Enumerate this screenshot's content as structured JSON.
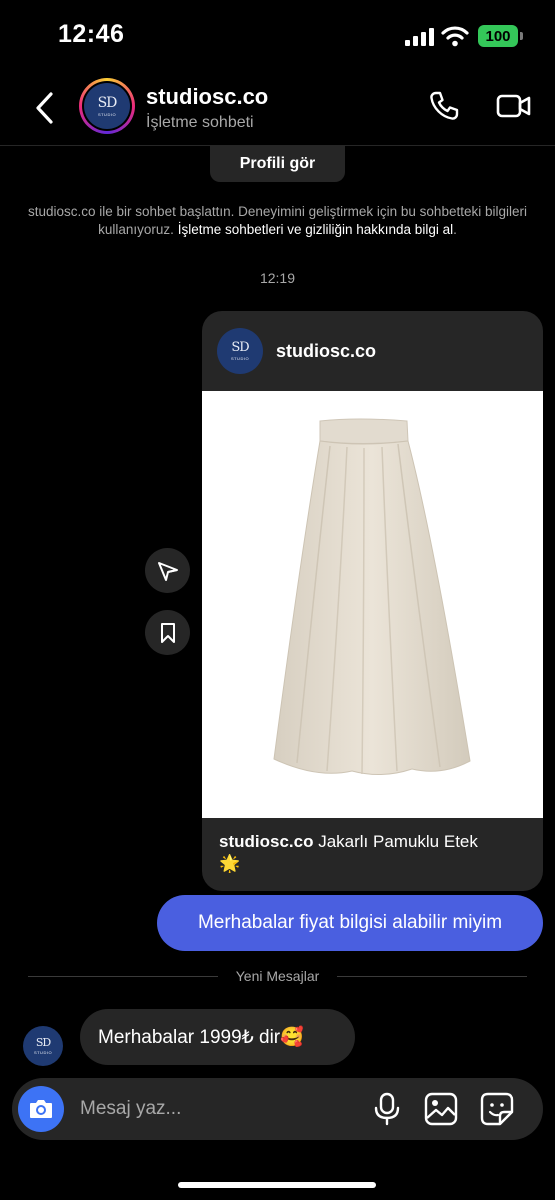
{
  "status_bar": {
    "time": "12:46",
    "battery": "100"
  },
  "header": {
    "title": "studiosc.co",
    "subtitle": "İşletme sohbeti"
  },
  "logo": {
    "monogram": "SD",
    "sub": "STUDIO"
  },
  "profile_button": "Profili gör",
  "info": {
    "text": "studiosc.co ile bir sohbet başlattın. Deneyimini geliştirmek için bu sohbetteki bilgileri kullanıyoruz. ",
    "link": "İşletme sohbetleri ve gizliliğin hakkında bilgi al",
    "end": "."
  },
  "timestamp": "12:19",
  "post": {
    "username": "studiosc.co",
    "caption_user": "studiosc.co",
    "caption_text": " Jakarlı Pamuklu Etek",
    "caption_emoji": "🌟"
  },
  "sent_message": "Merhabalar fiyat bilgisi alabilir miyim",
  "divider_label": "Yeni Mesajlar",
  "received_message": "Merhabalar 1999₺ dir🥰",
  "composer": {
    "placeholder": "Mesaj yaz..."
  },
  "colors": {
    "background": "#000000",
    "bubble_sent": "#4a5fe0",
    "bubble_received": "#262626",
    "camera_button": "#3d73f5",
    "battery": "#34c759"
  }
}
